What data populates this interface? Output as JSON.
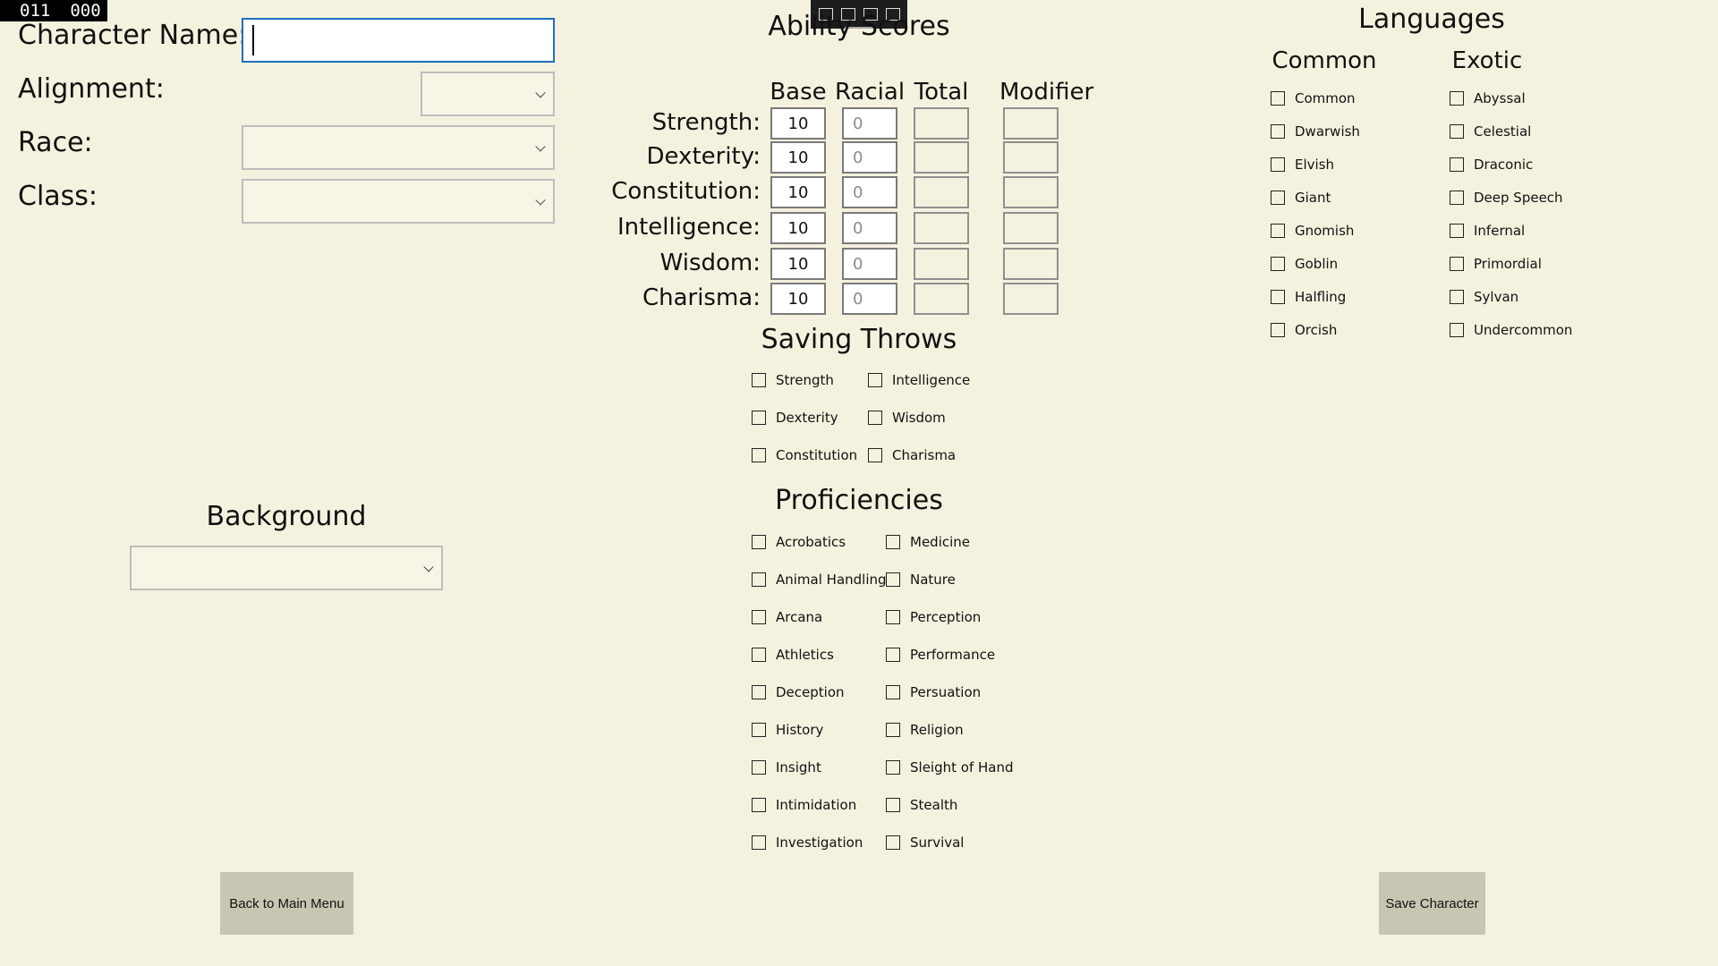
{
  "counter": {
    "left": "011",
    "right": "000"
  },
  "character": {
    "name_label": "Character Name:",
    "name_value": "",
    "alignment_label": "Alignment:",
    "race_label": "Race:",
    "class_label": "Class:"
  },
  "background": {
    "title": "Background"
  },
  "abilities": {
    "title": "Ability Scores",
    "columns": [
      "Base",
      "Racial",
      "Total",
      "Modifier"
    ],
    "rows": [
      {
        "name": "Strength:",
        "base": "10",
        "racial": "0"
      },
      {
        "name": "Dexterity:",
        "base": "10",
        "racial": "0"
      },
      {
        "name": "Constitution:",
        "base": "10",
        "racial": "0"
      },
      {
        "name": "Intelligence:",
        "base": "10",
        "racial": "0"
      },
      {
        "name": "Wisdom:",
        "base": "10",
        "racial": "0"
      },
      {
        "name": "Charisma:",
        "base": "10",
        "racial": "0"
      }
    ]
  },
  "saving_throws": {
    "title": "Saving Throws",
    "left": [
      "Strength",
      "Dexterity",
      "Constitution"
    ],
    "right": [
      "Intelligence",
      "Wisdom",
      "Charisma"
    ]
  },
  "proficiencies": {
    "title": "Proficiencies",
    "left": [
      "Acrobatics",
      "Animal Handling",
      "Arcana",
      "Athletics",
      "Deception",
      "History",
      "Insight",
      "Intimidation",
      "Investigation"
    ],
    "right": [
      "Medicine",
      "Nature",
      "Perception",
      "Performance",
      "Persuation",
      "Religion",
      "Sleight of Hand",
      "Stealth",
      "Survival"
    ]
  },
  "languages": {
    "title": "Languages",
    "common_title": "Common",
    "exotic_title": "Exotic",
    "common": [
      "Common",
      "Dwarwish",
      "Elvish",
      "Giant",
      "Gnomish",
      "Goblin",
      "Halfling",
      "Orcish"
    ],
    "exotic": [
      "Abyssal",
      "Celestial",
      "Draconic",
      "Deep Speech",
      "Infernal",
      "Primordial",
      "Sylvan",
      "Undercommon"
    ]
  },
  "buttons": {
    "back": "Back to Main Menu",
    "save": "Save Character"
  },
  "toolbar_icons": [
    "select-element-icon",
    "pointer-icon",
    "frame-icon",
    "track-focus-icon"
  ]
}
